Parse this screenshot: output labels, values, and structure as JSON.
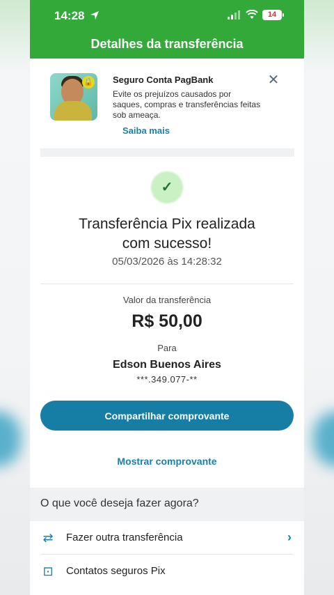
{
  "status_bar": {
    "time": "14:28",
    "battery": "14"
  },
  "header": {
    "title": "Detalhes da transferência"
  },
  "promo": {
    "title": "Seguro Conta PagBank",
    "text": "Evite os prejuízos causados por saques, compras e transferências feitas sob ameaça.",
    "link": "Saiba mais"
  },
  "success": {
    "title_line1": "Transferência Pix realizada",
    "title_line2": "com sucesso!",
    "datetime": "05/03/2026 às 14:28:32"
  },
  "transfer": {
    "value_label": "Valor da transferência",
    "value": "R$ 50,00",
    "to_label": "Para",
    "recipient": "Edson Buenos Aires",
    "document": "***.349.077-**"
  },
  "actions": {
    "share": "Compartilhar comprovante",
    "show": "Mostrar comprovante"
  },
  "next": {
    "title": "O que você deseja fazer agora?",
    "items": [
      {
        "label": "Fazer outra transferência",
        "icon": "transfer-arrows-icon"
      },
      {
        "label": "Contatos seguros Pix",
        "icon": "contact-shield-icon"
      }
    ]
  },
  "colors": {
    "brand_green": "#33a93a",
    "accent_blue": "#167ea4",
    "check_bg": "#c9f1c4"
  }
}
